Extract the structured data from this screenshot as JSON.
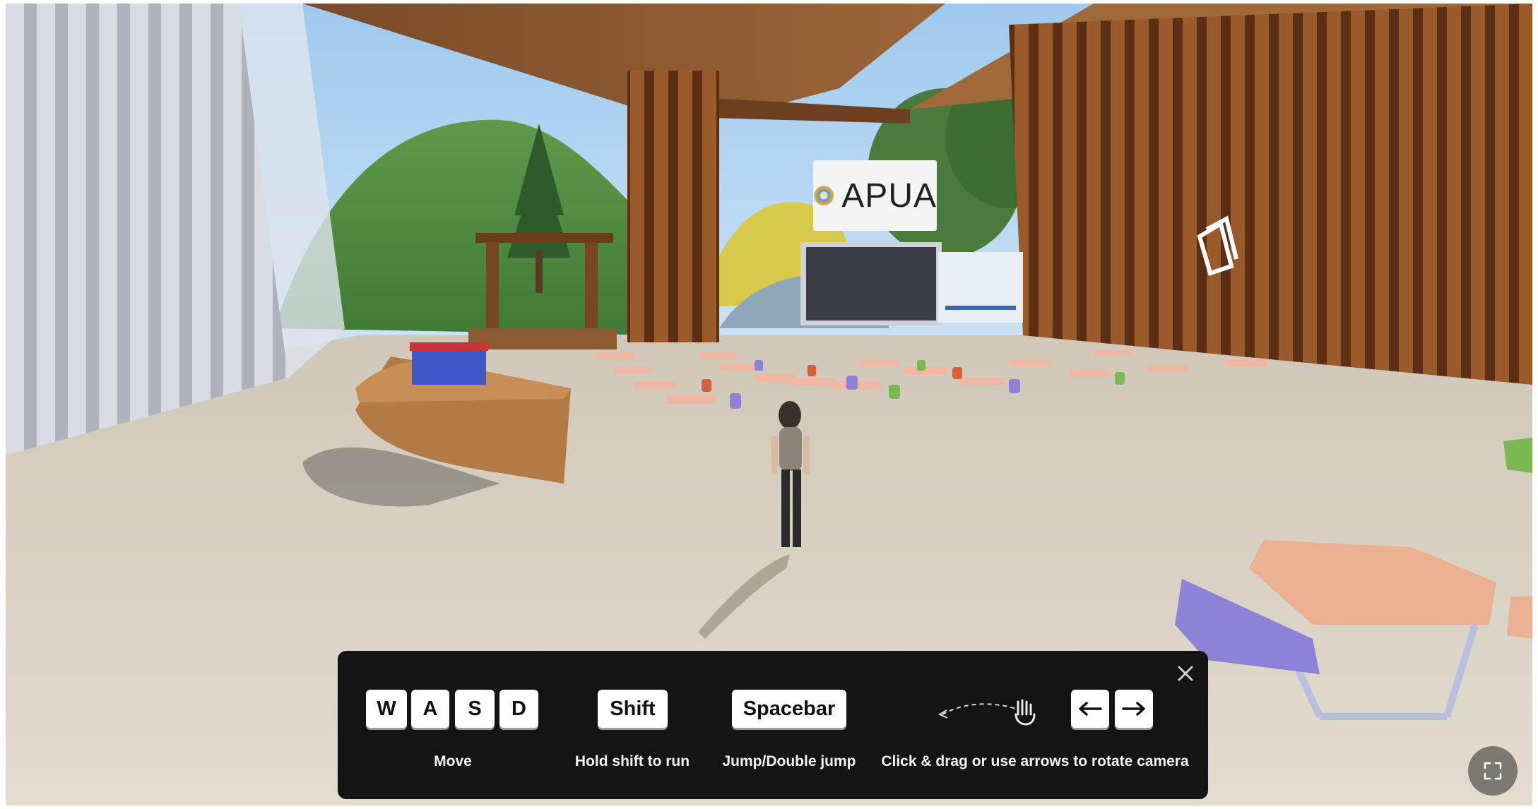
{
  "scene": {
    "sign_text": "APUA"
  },
  "controls_help": {
    "keys": {
      "w": "W",
      "a": "A",
      "s": "S",
      "d": "D",
      "shift": "Shift",
      "spacebar": "Spacebar"
    },
    "captions": {
      "move": "Move",
      "run": "Hold shift to run",
      "jump": "Jump/Double jump",
      "camera": "Click & drag or use arrows to rotate camera"
    },
    "close_icon": "close-icon",
    "arrow_icons": [
      "arrow-left-icon",
      "arrow-right-icon"
    ],
    "drag_icon": "hand-drag-icon"
  },
  "fullscreen_icon": "fullscreen-icon",
  "colors": {
    "panel_bg": "#141414",
    "key_bg": "#ffffff",
    "floor": "#d9d2c3",
    "wood": "#8a4f25",
    "chair_purple": "#8c82d6",
    "table_peach": "#eab092"
  }
}
